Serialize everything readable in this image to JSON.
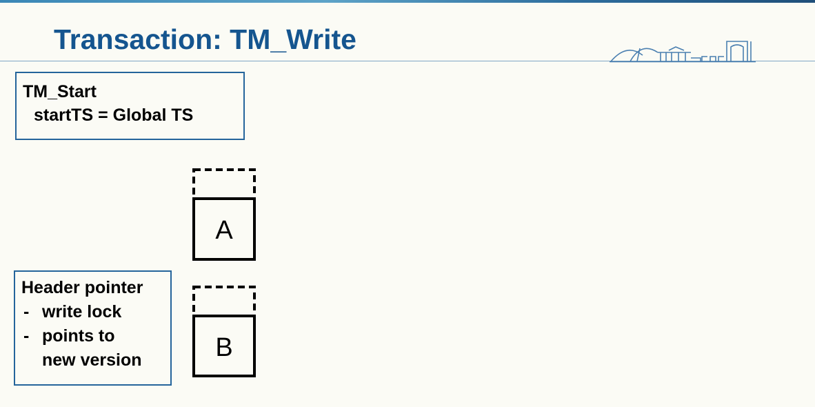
{
  "slide": {
    "title": "Transaction: TM_Write"
  },
  "start_box": {
    "heading": "TM_Start",
    "line": "startTS = Global TS"
  },
  "header_box": {
    "heading": "Header pointer",
    "bullets": [
      {
        "dash": "-",
        "text": "write lock"
      },
      {
        "dash": "-",
        "text": "points to"
      }
    ],
    "continuation": "new version"
  },
  "objects": [
    {
      "label": "A"
    },
    {
      "label": "B"
    }
  ],
  "colors": {
    "title": "#15558f",
    "box_border": "#24649b",
    "background": "#fbfbf5"
  },
  "icons": {
    "logo": "university-bridge-logo"
  }
}
